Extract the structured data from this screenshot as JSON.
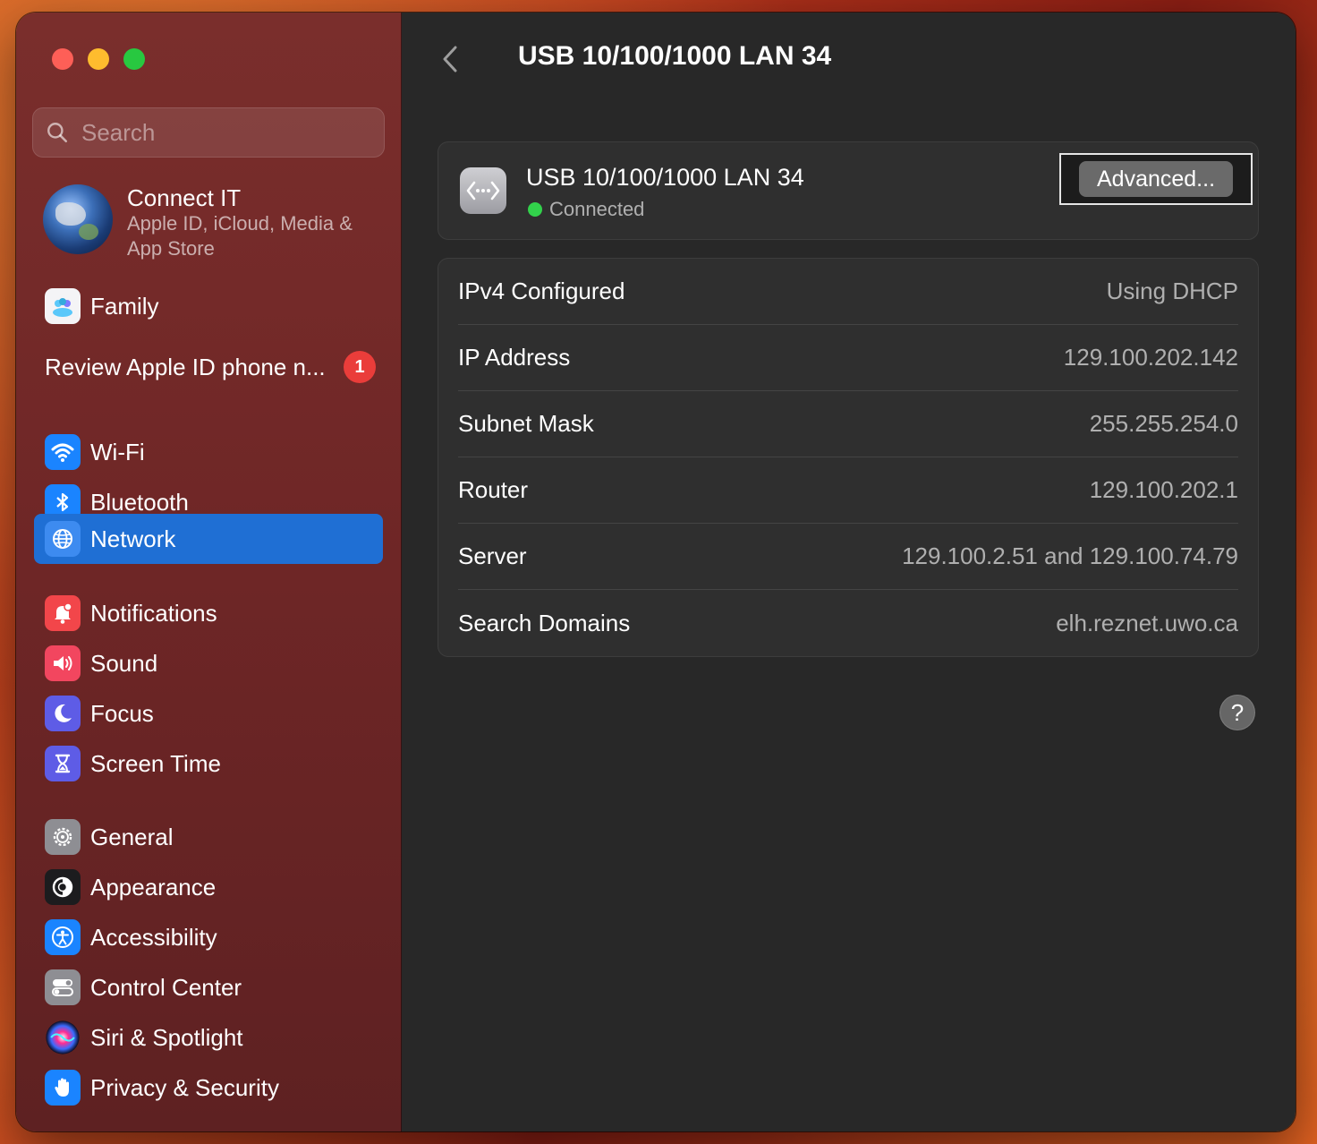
{
  "window": {
    "title": "USB 10/100/1000 LAN 34"
  },
  "sidebar": {
    "search_placeholder": "Search",
    "account": {
      "name": "Connect IT",
      "subtitle": "Apple ID, iCloud, Media & App Store"
    },
    "family_label": "Family",
    "review": {
      "label": "Review Apple ID phone n...",
      "badge": "1"
    },
    "items": [
      {
        "label": "Wi-Fi",
        "icon": "wifi-icon",
        "color": "#1a84ff"
      },
      {
        "label": "Bluetooth",
        "icon": "bluetooth-icon",
        "color": "#1a84ff"
      },
      {
        "label": "Network",
        "icon": "globe-icon",
        "color": "#1a84ff",
        "selected": true
      },
      {
        "label": "Notifications",
        "icon": "bell-icon",
        "color": "#f2464a"
      },
      {
        "label": "Sound",
        "icon": "speaker-icon",
        "color": "#f2465f"
      },
      {
        "label": "Focus",
        "icon": "moon-icon",
        "color": "#5e5ce6"
      },
      {
        "label": "Screen Time",
        "icon": "hourglass-icon",
        "color": "#5e5ce6"
      },
      {
        "label": "General",
        "icon": "gear-icon",
        "color": "#8e8e93"
      },
      {
        "label": "Appearance",
        "icon": "appearance-icon",
        "color": "#1c1c1e"
      },
      {
        "label": "Accessibility",
        "icon": "accessibility-icon",
        "color": "#1a84ff"
      },
      {
        "label": "Control Center",
        "icon": "toggles-icon",
        "color": "#8e8e93"
      },
      {
        "label": "Siri & Spotlight",
        "icon": "siri-icon",
        "color": "#2a2a2a"
      },
      {
        "label": "Privacy & Security",
        "icon": "hand-icon",
        "color": "#1a84ff"
      }
    ]
  },
  "main": {
    "title": "USB 10/100/1000 LAN 34",
    "connection": {
      "name": "USB 10/100/1000 LAN 34",
      "status": "Connected",
      "status_color": "#32d14b",
      "advanced_label": "Advanced..."
    },
    "details": [
      {
        "key": "IPv4 Configured",
        "value": "Using DHCP"
      },
      {
        "key": "IP Address",
        "value": "129.100.202.142"
      },
      {
        "key": "Subnet Mask",
        "value": "255.255.254.0"
      },
      {
        "key": "Router",
        "value": "129.100.202.1"
      },
      {
        "key": "Server",
        "value": "129.100.2.51 and 129.100.74.79"
      },
      {
        "key": "Search Domains",
        "value": "elh.reznet.uwo.ca"
      }
    ],
    "help_label": "?"
  }
}
